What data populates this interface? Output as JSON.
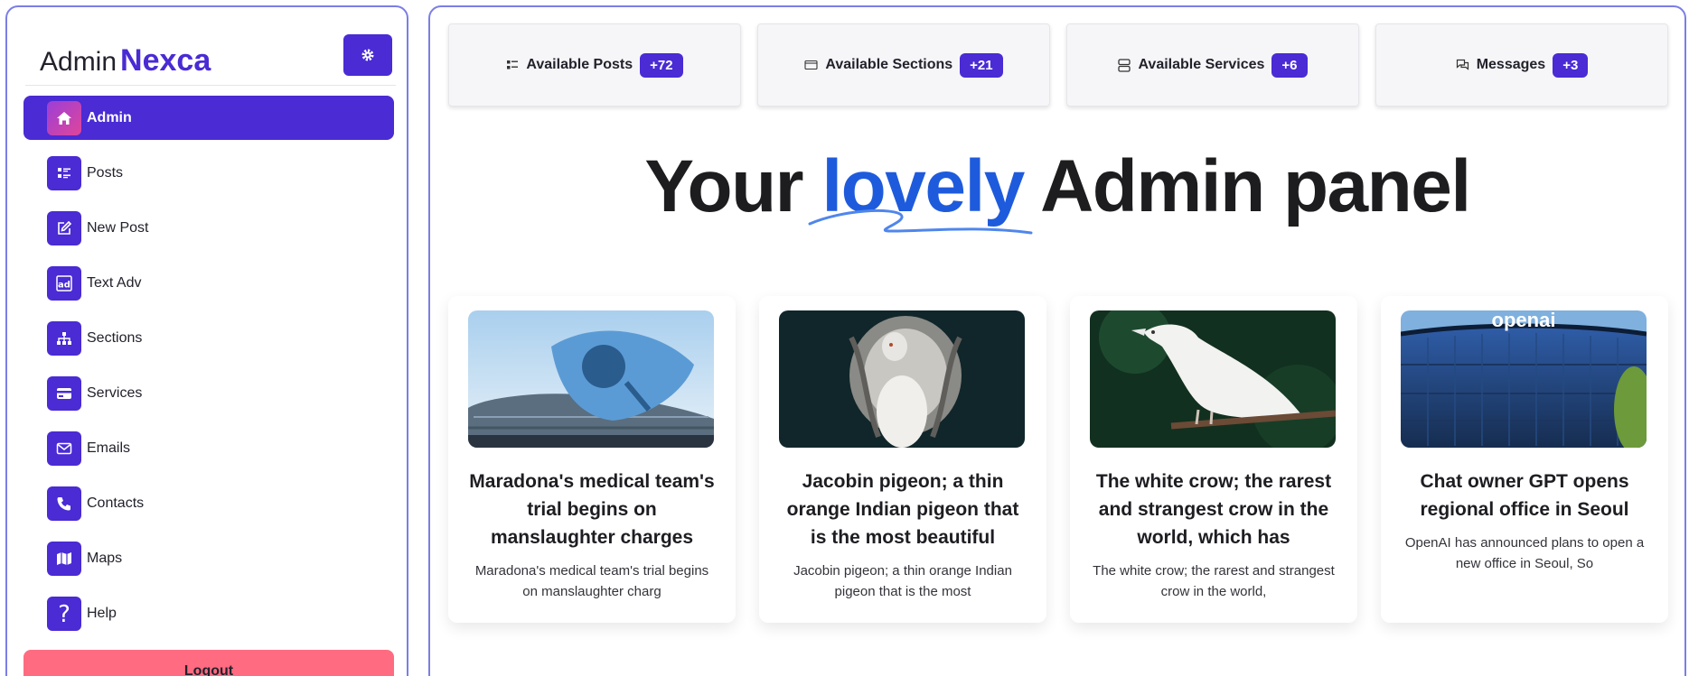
{
  "brand": {
    "prefix": "Admin",
    "name": "Nexca"
  },
  "sidebar": {
    "settings_icon": "gear-icon",
    "items": [
      {
        "label": "Admin",
        "icon": "home-icon",
        "active": true
      },
      {
        "label": "Posts",
        "icon": "posts-list-icon"
      },
      {
        "label": "New Post",
        "icon": "edit-icon"
      },
      {
        "label": "Text Adv",
        "icon": "ad-icon"
      },
      {
        "label": "Sections",
        "icon": "sitemap-icon"
      },
      {
        "label": "Services",
        "icon": "card-icon"
      },
      {
        "label": "Emails",
        "icon": "envelope-icon"
      },
      {
        "label": "Contacts",
        "icon": "phone-icon"
      },
      {
        "label": "Maps",
        "icon": "map-icon"
      },
      {
        "label": "Help",
        "icon": "question-icon"
      }
    ],
    "logout_label": "Logout"
  },
  "stats": [
    {
      "label": "Available Posts",
      "count": "+72",
      "icon": "posts-list-icon"
    },
    {
      "label": "Available Sections",
      "count": "+21",
      "icon": "window-icon"
    },
    {
      "label": "Available Services",
      "count": "+6",
      "icon": "server-icon"
    },
    {
      "label": "Messages",
      "count": "+3",
      "icon": "chat-icon"
    }
  ],
  "hero": {
    "before": "Your ",
    "accent": "lovely",
    "after": " Admin panel"
  },
  "colors": {
    "primary": "#4a2bd4",
    "accent": "#1e5bdc",
    "logout": "#ff6b81",
    "border": "#7b7ee6"
  },
  "posts": [
    {
      "title": "Maradona's medical team's trial begins on manslaughter charges",
      "excerpt": "Maradona's medical team's trial begins on manslaughter charg"
    },
    {
      "title": "Jacobin pigeon; a thin orange Indian pigeon that is the most beautiful",
      "excerpt": "Jacobin pigeon; a thin orange Indian pigeon that is the most"
    },
    {
      "title": "The white crow; the rarest and strangest crow in the world, which has",
      "excerpt": "The white crow; the rarest and strangest crow in the world,"
    },
    {
      "title": "Chat owner GPT opens regional office in Seoul",
      "excerpt": "OpenAI has announced plans to open a new office in Seoul, So",
      "image_text": "openai"
    }
  ]
}
